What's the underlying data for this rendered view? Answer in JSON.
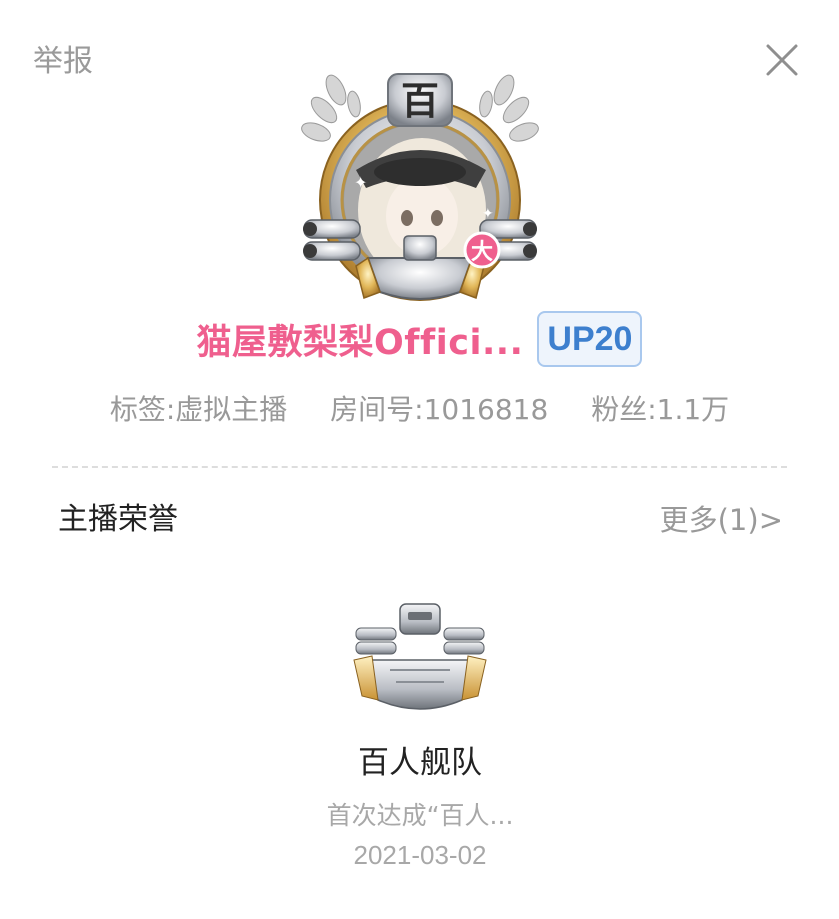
{
  "header": {
    "report_label": "举报",
    "close_icon": "close-icon"
  },
  "avatar": {
    "frame_icon": "fleet-medal-frame",
    "frame_glyph": "百",
    "level_badge": "大"
  },
  "streamer": {
    "name": "猫屋敷梨梨Offici...",
    "up_badge": "UP20",
    "name_color": "#ef5f8e",
    "badge_color": "#3d7fce"
  },
  "info": {
    "tag": "标签:虚拟主播",
    "room": "房间号:1016818",
    "fans": "粉丝:1.1万"
  },
  "honors": {
    "title": "主播荣誉",
    "more": "更多(1)>",
    "items": [
      {
        "icon": "hundred-fleet-badge-icon",
        "name": "百人舰队",
        "description": "首次达成“百人...",
        "date": "2021-03-02"
      }
    ]
  }
}
